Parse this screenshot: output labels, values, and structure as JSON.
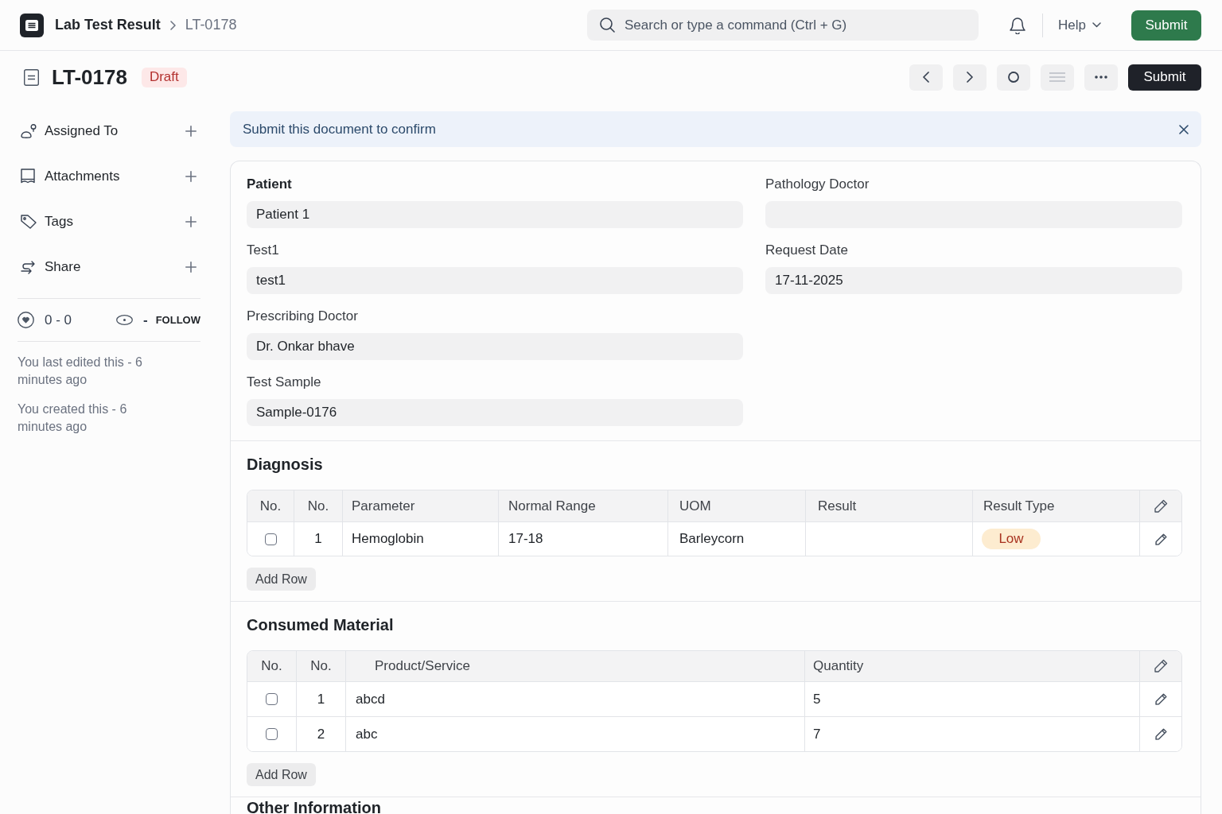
{
  "navbar": {
    "breadcrumbs": [
      "Lab Test Result",
      "LT-0178"
    ],
    "search": {
      "placeholder": "Search or type a command (Ctrl + G)"
    },
    "help": "Help",
    "primary_button": "Submit"
  },
  "header": {
    "title": "LT-0178",
    "status": "Draft",
    "primary_button": "Submit"
  },
  "sidebar": {
    "items": [
      {
        "kind": "assign",
        "label": "Assigned To"
      },
      {
        "kind": "attachments",
        "label": "Attachments"
      },
      {
        "kind": "tags",
        "label": "Tags"
      },
      {
        "kind": "share",
        "label": "Share"
      }
    ],
    "likes": "0 - 0",
    "followers": "-",
    "follow": "FOLLOW",
    "timeline": [
      "You last edited this - 6 minutes ago",
      "You created this - 6 minutes ago"
    ]
  },
  "alert": {
    "text": "Submit this document to confirm"
  },
  "form": {
    "columns": [
      [
        {
          "label": "Patient",
          "bold": true,
          "value": "Patient 1"
        },
        {
          "label": "Test1",
          "bold": false,
          "value": "test1"
        },
        {
          "label": "Prescribing Doctor",
          "bold": false,
          "value": "Dr. Onkar bhave"
        },
        {
          "label": "Test Sample",
          "bold": false,
          "value": "Sample-0176"
        }
      ],
      [
        {
          "label": "Pathology Doctor",
          "bold": false
        },
        {
          "label": "Request Date",
          "bold": false,
          "value": "17-11-2025"
        }
      ]
    ]
  },
  "diagnosis": {
    "title": "Diagnosis",
    "columns": [
      "No.",
      "No.",
      "Parameter",
      "Normal Range",
      "UOM",
      "Result",
      "Result Type"
    ],
    "rows": [
      {
        "checked": false,
        "no": "1",
        "parameter": "Hemoglobin",
        "normal_range": "17-18",
        "uom": "Barleycorn",
        "result_type": "Low"
      }
    ],
    "add_row": "Add Row"
  },
  "consumed_material": {
    "title": "Consumed Material",
    "columns": [
      "No.",
      "No.",
      "Product/Service",
      "Quantity"
    ],
    "rows": [
      {
        "checked": false,
        "no": "1",
        "item": "abcd",
        "quantity": "5"
      },
      {
        "checked": false,
        "no": "2",
        "item": "abc",
        "quantity": "7"
      }
    ],
    "add_row": "Add Row"
  },
  "other_information": {
    "title": "Other Information"
  }
}
